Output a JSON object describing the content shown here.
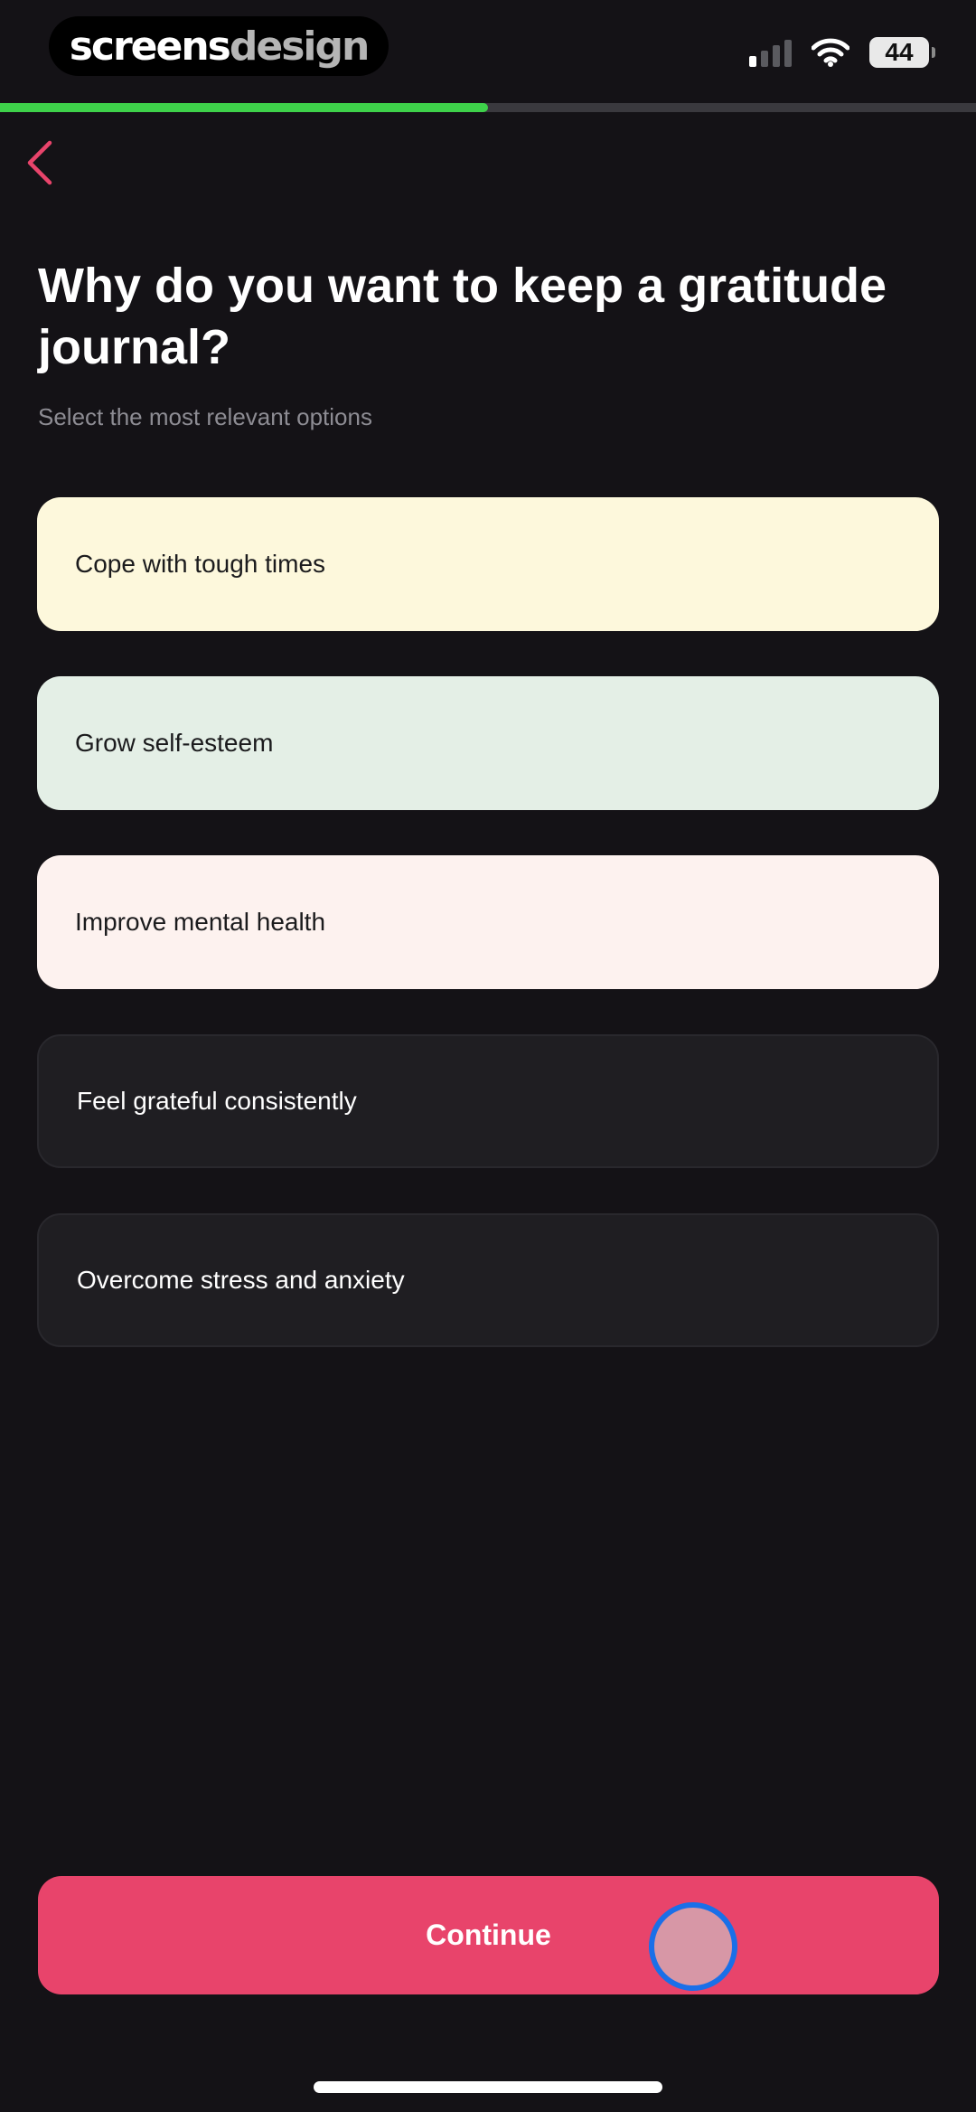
{
  "watermark": {
    "part1": "screens",
    "part2": "design"
  },
  "status_bar": {
    "battery": "44",
    "signal_bars_active": 1,
    "signal_bars_total": 4
  },
  "progress": {
    "fraction": 0.5
  },
  "back_icon": "chevron-left-icon",
  "title": "Why do you want to keep a gratitude journal?",
  "subtitle": "Select the most relevant options",
  "options": [
    {
      "label": "Cope with tough times",
      "selected": true,
      "color": "#fdf8dc"
    },
    {
      "label": "Grow self-esteem",
      "selected": true,
      "color": "#e4efe6"
    },
    {
      "label": "Improve mental health",
      "selected": true,
      "color": "#fdf2ef"
    },
    {
      "label": "Feel grateful consistently",
      "selected": false
    },
    {
      "label": "Overcome stress and anxiety",
      "selected": false
    }
  ],
  "continue_label": "Continue",
  "colors": {
    "background": "#141216",
    "accent": "#e8446b",
    "progress": "#3ed14a",
    "back_icon": "#e8446b"
  }
}
